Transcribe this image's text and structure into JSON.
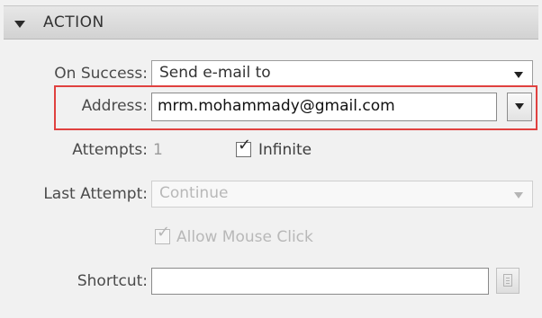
{
  "section": {
    "title": "ACTION"
  },
  "on_success": {
    "label": "On Success:",
    "value": "Send e-mail to"
  },
  "address": {
    "label": "Address:",
    "value": "mrm.mohammady@gmail.com"
  },
  "attempts": {
    "label": "Attempts:",
    "value": "1",
    "infinite_label": "Infinite",
    "infinite_checked": true
  },
  "last_attempt": {
    "label": "Last Attempt:",
    "value": "Continue"
  },
  "allow_mouse_click": {
    "label": "Allow Mouse Click",
    "checked": true
  },
  "shortcut": {
    "label": "Shortcut:",
    "value": ""
  },
  "colors": {
    "highlight": "#e0413f"
  }
}
